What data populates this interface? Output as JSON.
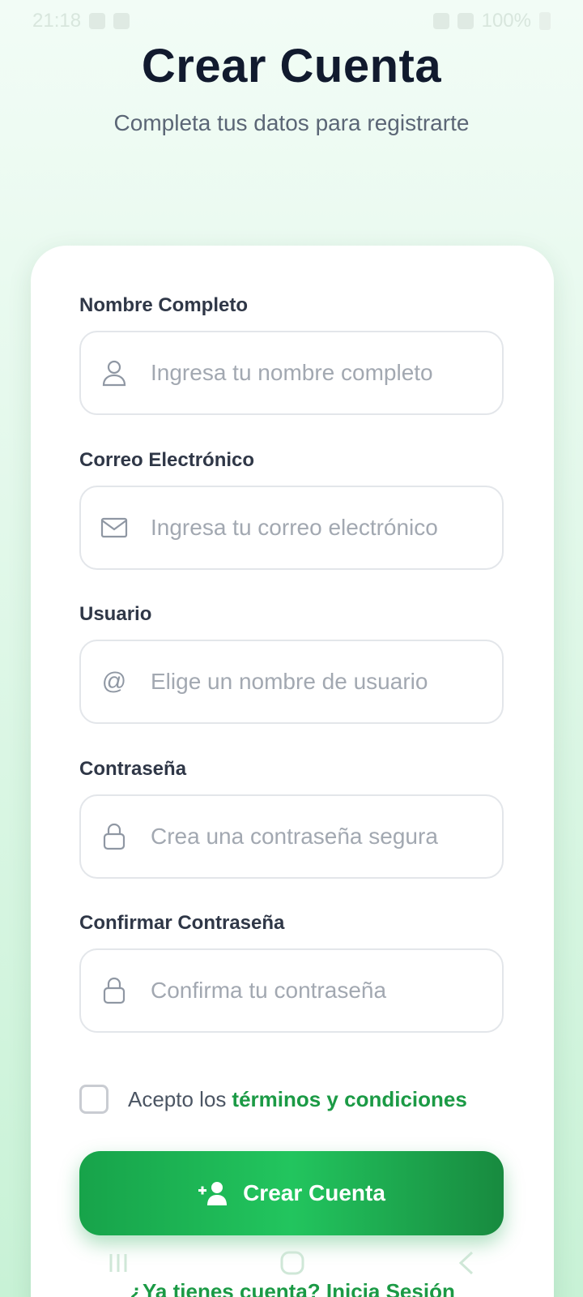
{
  "status_bar": {
    "time": "21:18",
    "battery": "100%"
  },
  "header": {
    "title": "Crear Cuenta",
    "subtitle": "Completa tus datos para registrarte"
  },
  "form": {
    "fields": [
      {
        "label": "Nombre Completo",
        "placeholder": "Ingresa tu nombre completo",
        "icon": "user-icon",
        "value": ""
      },
      {
        "label": "Correo Electrónico",
        "placeholder": "Ingresa tu correo electrónico",
        "icon": "mail-icon",
        "value": ""
      },
      {
        "label": "Usuario",
        "placeholder": "Elige un nombre de usuario",
        "icon": "at-icon",
        "value": ""
      },
      {
        "label": "Contraseña",
        "placeholder": "Crea una contraseña segura",
        "icon": "lock-icon",
        "value": ""
      },
      {
        "label": "Confirmar Contraseña",
        "placeholder": "Confirma tu contraseña",
        "icon": "lock-icon",
        "value": ""
      }
    ],
    "terms": {
      "prefix": "Acepto los",
      "link": "términos y condiciones",
      "checked": false
    },
    "submit_label": "Crear Cuenta"
  },
  "footer": {
    "login_prompt": "¿Ya tienes cuenta? Inicia Sesión"
  },
  "colors": {
    "accent": "#16a34a",
    "title": "#111a2e",
    "background": "#e2f8ea"
  }
}
